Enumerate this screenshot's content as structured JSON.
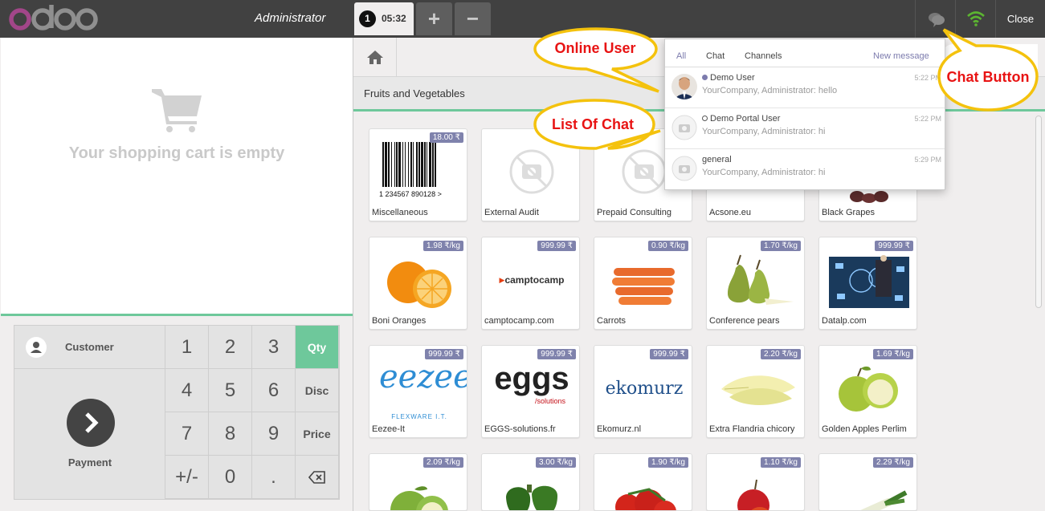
{
  "topbar": {
    "logo_text": "odoo",
    "user": "Administrator",
    "order_number": "1",
    "order_time": "05:32",
    "add_order": "+",
    "remove_order": "−",
    "chat_icon": "chat-bubbles-icon",
    "wifi_icon": "wifi-icon",
    "close_label": "Close"
  },
  "cart": {
    "empty_message": "Your shopping cart is empty",
    "icon": "shopping-cart-icon"
  },
  "pad": {
    "customer_label": "Customer",
    "payment_label": "Payment",
    "keys": [
      "1",
      "2",
      "3",
      "4",
      "5",
      "6",
      "7",
      "8",
      "9",
      "+/-",
      "0",
      "."
    ],
    "modes": [
      "Qty",
      "Disc",
      "Price"
    ],
    "active_mode": "Qty",
    "backspace_icon": "backspace-icon"
  },
  "category": {
    "home_icon": "home-icon",
    "label": "Fruits and Vegetables"
  },
  "products": [
    {
      "name": "Miscellaneous",
      "price": "18.00 ₹",
      "image": "barcode",
      "barcode_text": "1  234567  890128  >"
    },
    {
      "name": "External Audit",
      "price": "",
      "image": "placeholder"
    },
    {
      "name": "Prepaid Consulting",
      "price": "",
      "image": "placeholder"
    },
    {
      "name": "Acsone.eu",
      "price": "",
      "image": "none"
    },
    {
      "name": "Black Grapes",
      "price": "",
      "image": "grapes"
    },
    {
      "name": "Boni Oranges",
      "price": "1.98 ₹/kg",
      "image": "orange"
    },
    {
      "name": "camptocamp.com",
      "price": "999.99 ₹",
      "image": "camptocamp",
      "logo_text": "camptocamp"
    },
    {
      "name": "Carrots",
      "price": "0.90 ₹/kg",
      "image": "carrots"
    },
    {
      "name": "Conference pears",
      "price": "1.70 ₹/kg",
      "image": "pears"
    },
    {
      "name": "Datalp.com",
      "price": "999.99 ₹",
      "image": "datalp"
    },
    {
      "name": "Eezee-It",
      "price": "999.99 ₹",
      "image": "eezee",
      "logo_text": "eezee",
      "logo_sub": "FLEXWARE I.T."
    },
    {
      "name": "EGGS-solutions.fr",
      "price": "999.99 ₹",
      "image": "eggs",
      "logo_text": "eggs",
      "logo_sub": "/solutions"
    },
    {
      "name": "Ekomurz.nl",
      "price": "999.99 ₹",
      "image": "ekomurz",
      "logo_text": "ekomurz"
    },
    {
      "name": "Extra Flandria chicory",
      "price": "2.20 ₹/kg",
      "image": "chicory"
    },
    {
      "name": "Golden Apples Perlim",
      "price": "1.69 ₹/kg",
      "image": "green-apples"
    },
    {
      "name": "",
      "price": "2.09 ₹/kg",
      "image": "green-apple-2"
    },
    {
      "name": "",
      "price": "3.00 ₹/kg",
      "image": "peppers"
    },
    {
      "name": "",
      "price": "1.90 ₹/kg",
      "image": "tomatoes"
    },
    {
      "name": "",
      "price": "1.10 ₹/kg",
      "image": "red-apples"
    },
    {
      "name": "",
      "price": "2.29 ₹/kg",
      "image": "leek"
    }
  ],
  "chat": {
    "tabs": [
      "All",
      "Chat",
      "Channels"
    ],
    "active_tab": "All",
    "new_message": "New message",
    "items": [
      {
        "name": "Demo User",
        "snippet": "YourCompany, Administrator: hello",
        "time": "5:22 PM",
        "status": "online"
      },
      {
        "name": "Demo Portal User",
        "snippet": "YourCompany, Administrator: hi",
        "time": "5:22 PM",
        "status": "offline"
      },
      {
        "name": "general",
        "snippet": "YourCompany, Administrator: hi",
        "time": "5:29 PM",
        "status": "none"
      }
    ]
  },
  "callouts": {
    "online_user": "Online User",
    "list_of_chat": "List Of Chat",
    "chat_button": "Chat Button"
  },
  "colors": {
    "accent_green": "#6ec89b",
    "price_tag": "#7f82ac",
    "topbar": "#414141",
    "callout_fill": "#ffffff",
    "callout_stroke": "#f4c20d",
    "callout_text": "#e81313"
  }
}
